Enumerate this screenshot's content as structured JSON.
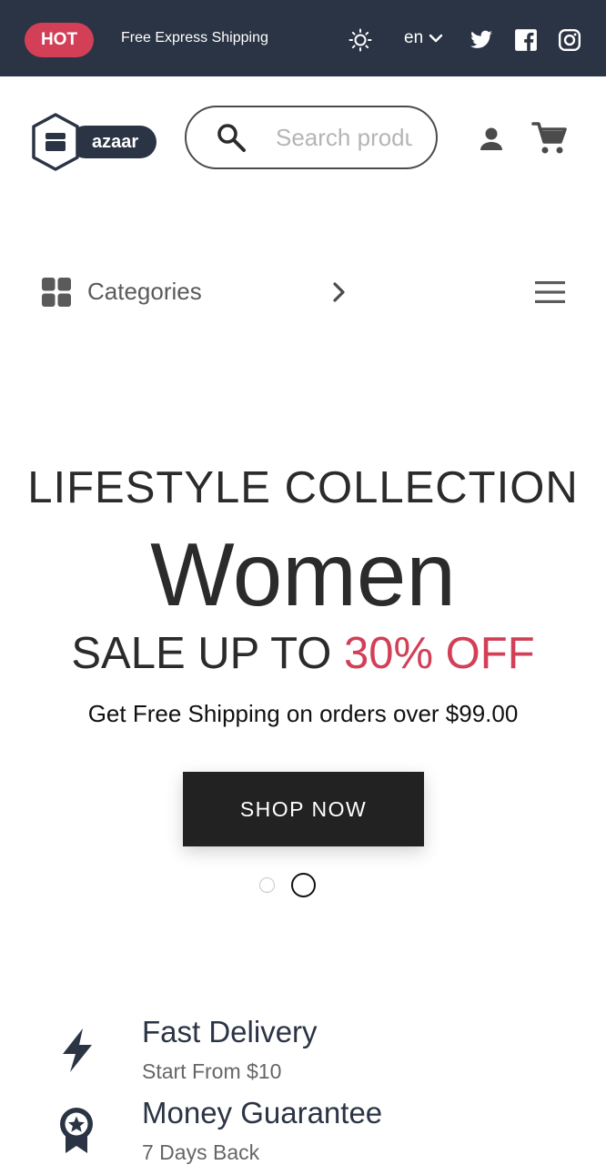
{
  "topbar": {
    "hot_label": "HOT",
    "shipping_text": "Free Express Shipping",
    "language": "en",
    "icons": [
      "sun-icon",
      "chevron-down-icon",
      "twitter-icon",
      "facebook-icon",
      "instagram-icon"
    ]
  },
  "header": {
    "logo_text": "azaar",
    "search_placeholder": "Search products...",
    "icons": [
      "search-icon",
      "user-icon",
      "cart-icon"
    ]
  },
  "categories": {
    "label": "Categories",
    "icons": [
      "grid-icon",
      "chevron-right-icon",
      "hamburger-menu-icon"
    ]
  },
  "hero": {
    "kicker": "LIFESTYLE COLLECTION",
    "title": "Women",
    "sale_prefix": "SALE UP TO ",
    "sale_accent": "30% OFF",
    "subtitle": "Get Free Shipping on orders over $99.00",
    "button_label": "SHOP NOW",
    "slides": 2,
    "active_slide": 2
  },
  "features": [
    {
      "title": "Fast Delivery",
      "subtitle": "Start From $10",
      "icon": "lightning-icon"
    },
    {
      "title": "Money Guarantee",
      "subtitle": "7 Days Back",
      "icon": "award-badge-icon"
    }
  ],
  "colors": {
    "topbar_bg": "#2b3445",
    "accent": "#d23f57",
    "button_bg": "#222222",
    "text_dark": "#2b2b2b"
  }
}
